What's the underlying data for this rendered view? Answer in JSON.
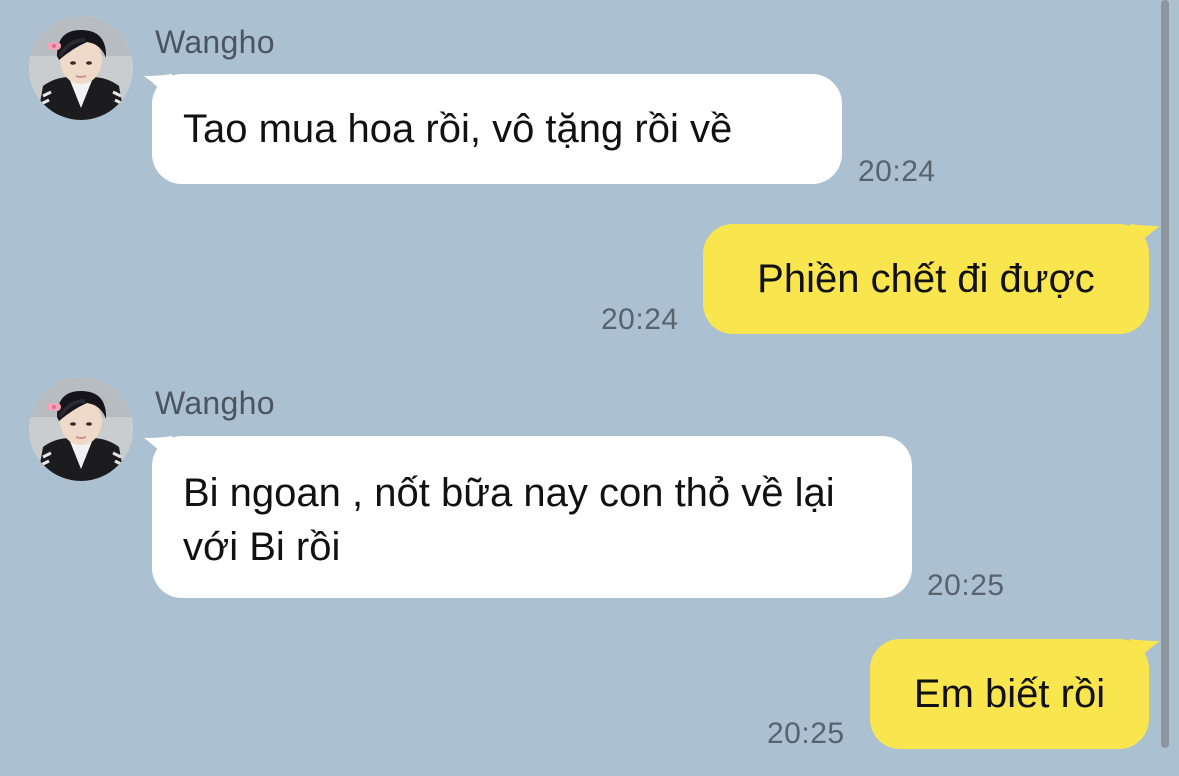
{
  "theme": {
    "chat_background": "#abc1d1",
    "incoming_bubble": "#ffffff",
    "outgoing_bubble": "#f9e54e"
  },
  "messages": [
    {
      "direction": "incoming",
      "sender": "Wangho",
      "text": "Tao mua hoa rồi, vô tặng rồi về",
      "time": "20:24"
    },
    {
      "direction": "outgoing",
      "text": "Phiền chết đi được",
      "time": "20:24"
    },
    {
      "direction": "incoming",
      "sender": "Wangho",
      "text": "Bi ngoan , nốt bữa nay con thỏ về lại với Bi rồi",
      "time": "20:25"
    },
    {
      "direction": "outgoing",
      "text": "Em biết rồi",
      "time": "20:25"
    }
  ]
}
